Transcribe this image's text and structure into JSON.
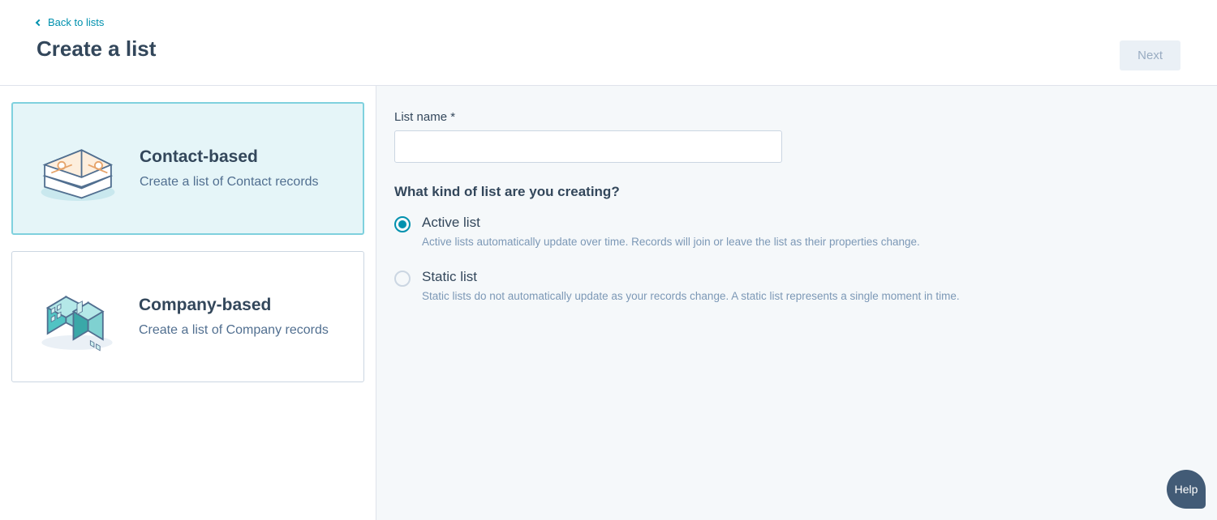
{
  "header": {
    "back_label": "Back to lists",
    "title": "Create a list",
    "next_label": "Next"
  },
  "type_cards": {
    "contact": {
      "title": "Contact-based",
      "desc": "Create a list of Contact records",
      "selected": true
    },
    "company": {
      "title": "Company-based",
      "desc": "Create a list of Company records",
      "selected": false
    }
  },
  "form": {
    "list_name_label": "List name *",
    "list_name_value": "",
    "kind_heading": "What kind of list are you creating?",
    "options": {
      "active": {
        "label": "Active list",
        "desc": "Active lists automatically update over time. Records will join or leave the list as their properties change.",
        "selected": true
      },
      "static": {
        "label": "Static list",
        "desc": "Static lists do not automatically update as your records change. A static list represents a single moment in time.",
        "selected": false
      }
    }
  },
  "help_label": "Help"
}
